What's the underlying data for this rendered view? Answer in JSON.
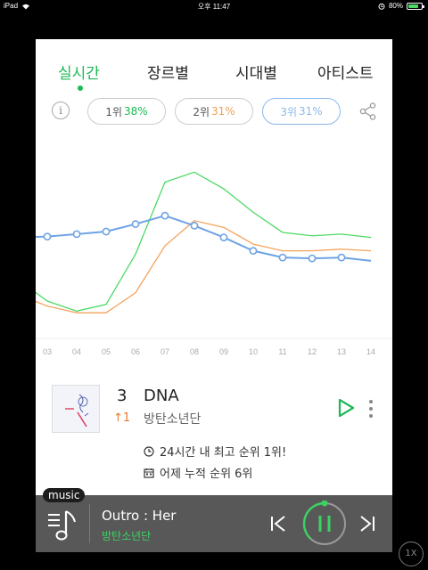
{
  "status_bar": {
    "device": "iPad",
    "time": "오후 11:47",
    "battery": "80%",
    "battery_level": 0.8
  },
  "tabs": [
    {
      "label": "실시간",
      "active": true
    },
    {
      "label": "장르별",
      "active": false
    },
    {
      "label": "시대별",
      "active": false
    },
    {
      "label": "아티스트",
      "active": false
    }
  ],
  "filters": {
    "info_icon": "info-icon",
    "pills": [
      {
        "prefix": "1위",
        "pct": "38%",
        "color": "#1db954",
        "selected": false
      },
      {
        "prefix": "2위",
        "pct": "31%",
        "color": "#f0a050",
        "selected": false
      },
      {
        "prefix": "3위",
        "pct": "31%",
        "color": "#8ab9ea",
        "selected": true
      }
    ],
    "share_icon": "share-icon"
  },
  "chart_data": {
    "type": "line",
    "x": [
      "03",
      "04",
      "05",
      "06",
      "07",
      "08",
      "09",
      "10",
      "11",
      "12",
      "13",
      "14"
    ],
    "ylim": [
      0,
      100
    ],
    "grid": false,
    "series": [
      {
        "color": "#4cd964",
        "values": [
          30,
          17,
          11,
          15,
          45,
          88,
          94,
          84,
          70,
          58,
          56,
          57,
          55
        ]
      },
      {
        "color": "#f5a35a",
        "values": [
          21,
          14,
          10,
          10,
          22,
          50,
          65,
          61,
          51,
          47,
          47,
          48,
          47
        ]
      },
      {
        "color": "#6fa3e3",
        "values": [
          55,
          55.5,
          57,
          58.5,
          63,
          68,
          62,
          55,
          47,
          43,
          42.5,
          43,
          41
        ],
        "markers": true
      }
    ]
  },
  "song": {
    "rank": "3",
    "change": "↑1",
    "title": "DNA",
    "artist": "방탄소년단",
    "info1": "24시간 내 최고 순위 1위!",
    "info2": "어제 누적 순위 6위",
    "icons": [
      "play-icon",
      "more-icon",
      "clock-icon",
      "calendar-icon"
    ]
  },
  "player": {
    "badge": "music",
    "title": "Outro : Her",
    "artist": "방탄소년단",
    "progress": 0.38,
    "icons": [
      "playlist-music-icon",
      "previous-icon",
      "pause-icon",
      "next-icon"
    ]
  },
  "speed": "1X"
}
